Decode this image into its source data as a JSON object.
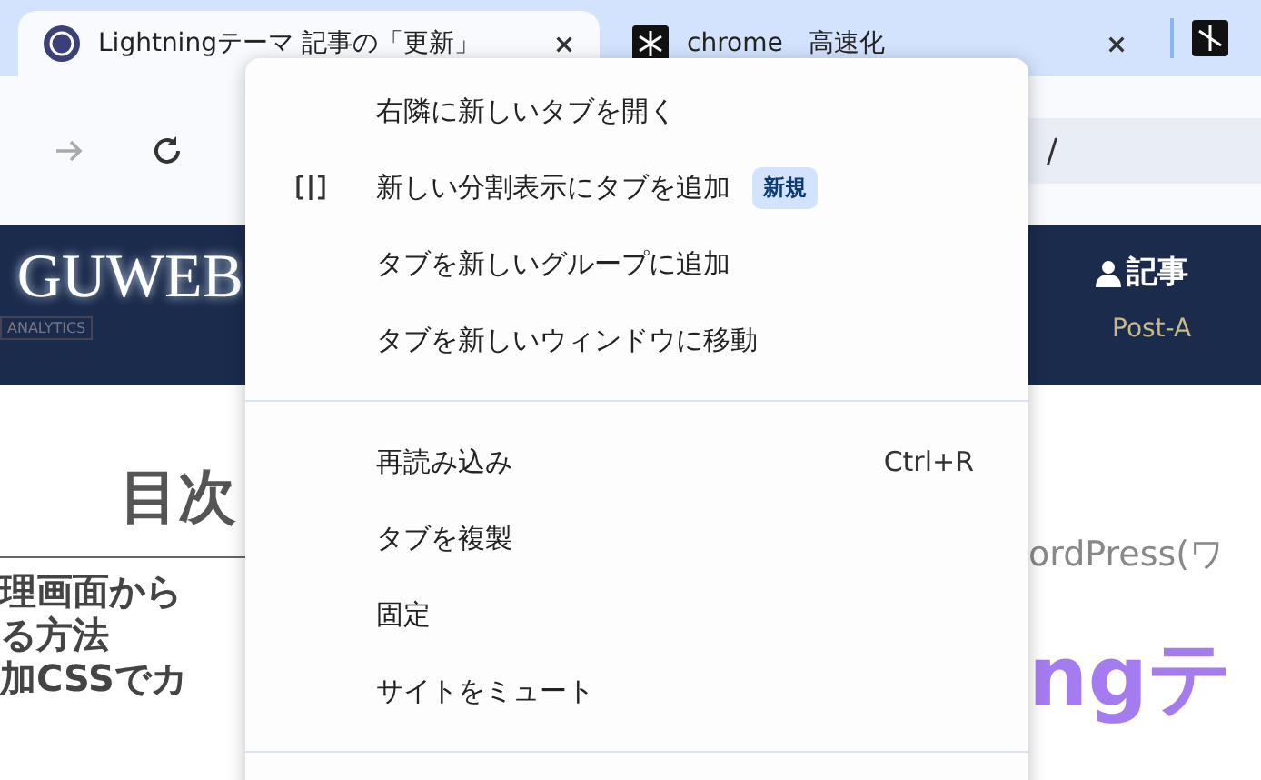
{
  "tabs": [
    {
      "title": "Lightningテーマ 記事の「更新」",
      "selected": true
    },
    {
      "title": "chrome　高速化",
      "selected": false
    }
  ],
  "address_bar": {
    "value": "/"
  },
  "page": {
    "header": {
      "logo": "GUWEB",
      "logo_tag": "ANALYTICS",
      "nav_title": "記事",
      "nav_subtitle": "Post-A"
    },
    "toc_title": "目次",
    "toc_items": [
      "理画面から",
      "る方法",
      "加CSSでカ"
    ],
    "breadcrumb": "ordPress(ワ",
    "headline": "ngテ"
  },
  "context_menu": [
    {
      "kind": "item",
      "label": "右隣に新しいタブを開く"
    },
    {
      "kind": "split",
      "label": "新しい分割表示にタブを追加",
      "badge": "新規"
    },
    {
      "kind": "item",
      "label": "タブを新しいグループに追加"
    },
    {
      "kind": "item",
      "label": "タブを新しいウィンドウに移動"
    },
    {
      "kind": "separator"
    },
    {
      "kind": "item",
      "label": "再読み込み",
      "shortcut": "Ctrl+R"
    },
    {
      "kind": "item",
      "label": "タブを複製"
    },
    {
      "kind": "item",
      "label": "固定"
    },
    {
      "kind": "item",
      "label": "サイトをミュート"
    },
    {
      "kind": "separator"
    }
  ]
}
